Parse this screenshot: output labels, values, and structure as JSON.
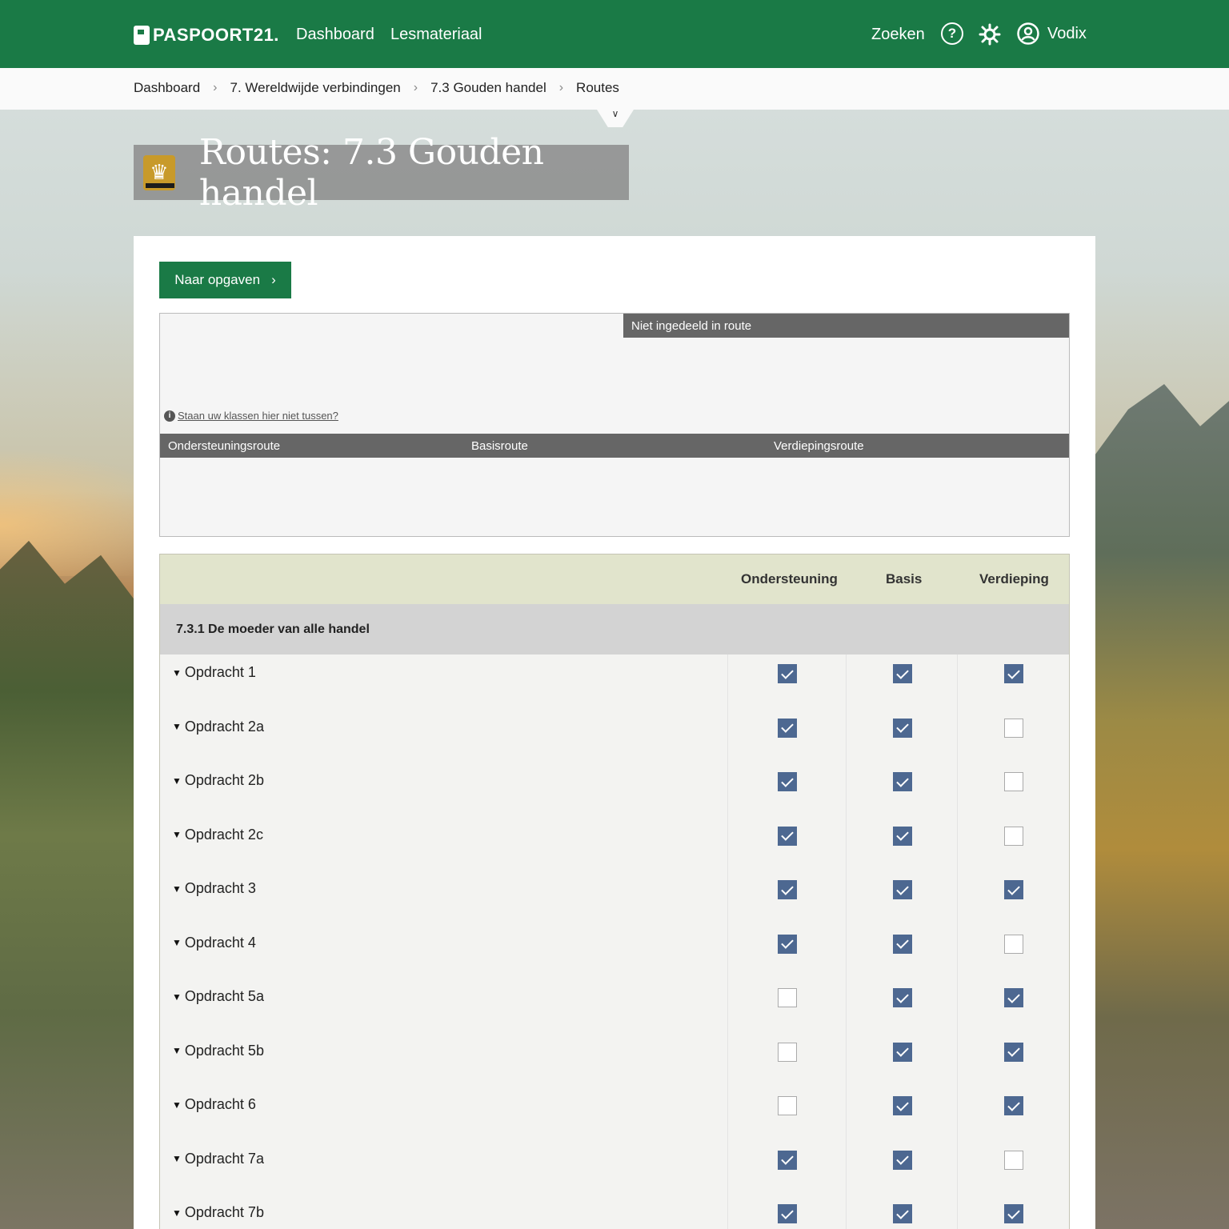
{
  "nav": {
    "logo": "PASPOORT21.",
    "links": [
      "Dashboard",
      "Lesmateriaal"
    ],
    "search": "Zoeken",
    "user": "Vodix",
    "help_icon": "?",
    "settings_icon": "gear-icon"
  },
  "breadcrumb": [
    "Dashboard",
    "7. Wereldwijde verbindingen",
    "7.3 Gouden handel",
    "Routes"
  ],
  "page": {
    "title": "Routes: 7.3 Gouden handel",
    "icon": "crown-icon"
  },
  "actions": {
    "to_tasks": "Naar opgaven"
  },
  "routes": {
    "unassigned": "Niet ingedeeld in route",
    "help": "Staan uw klassen hier niet tussen?",
    "columns": [
      "Ondersteuningsroute",
      "Basisroute",
      "Verdiepingsroute"
    ]
  },
  "table": {
    "headers": [
      "Ondersteuning",
      "Basis",
      "Verdieping"
    ],
    "section": "7.3.1 De moeder van alle handel",
    "rows": [
      {
        "label": "Opdracht 1",
        "checks": [
          true,
          true,
          true
        ]
      },
      {
        "label": "Opdracht 2a",
        "checks": [
          true,
          true,
          false
        ]
      },
      {
        "label": "Opdracht 2b",
        "checks": [
          true,
          true,
          false
        ]
      },
      {
        "label": "Opdracht 2c",
        "checks": [
          true,
          true,
          false
        ]
      },
      {
        "label": "Opdracht 3",
        "checks": [
          true,
          true,
          true
        ]
      },
      {
        "label": "Opdracht 4",
        "checks": [
          true,
          true,
          false
        ]
      },
      {
        "label": "Opdracht 5a",
        "checks": [
          false,
          true,
          true
        ]
      },
      {
        "label": "Opdracht 5b",
        "checks": [
          false,
          true,
          true
        ]
      },
      {
        "label": "Opdracht 6",
        "checks": [
          false,
          true,
          true
        ]
      },
      {
        "label": "Opdracht 7a",
        "checks": [
          true,
          true,
          false
        ]
      },
      {
        "label": "Opdracht 7b",
        "checks": [
          true,
          true,
          true
        ]
      }
    ]
  },
  "colors": {
    "brand_green": "#1a7a46",
    "checkbox_blue": "#4d6891",
    "header_tint": "#e1e4cc"
  }
}
